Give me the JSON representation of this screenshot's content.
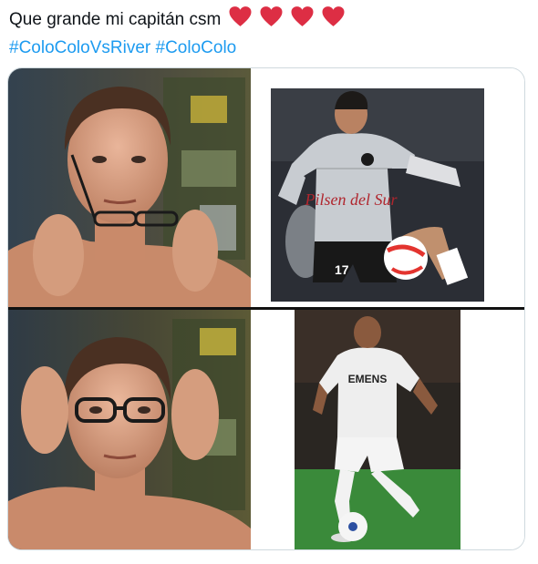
{
  "tweet": {
    "text_line1": "Que grande mi capitán csm",
    "hearts": [
      "heart-1",
      "heart-2",
      "heart-3",
      "heart-4"
    ],
    "hashtags": [
      "#ColoColoVsRiver",
      "#ColoColo"
    ]
  },
  "meme": {
    "top_right": {
      "sponsor": "Pilsen del Sur",
      "number": "17"
    },
    "bottom_right": {
      "sponsor": "EMENS"
    }
  },
  "colors": {
    "heart": "#e0245e",
    "hashtag": "#1d9bf0",
    "text": "#0f1419"
  }
}
